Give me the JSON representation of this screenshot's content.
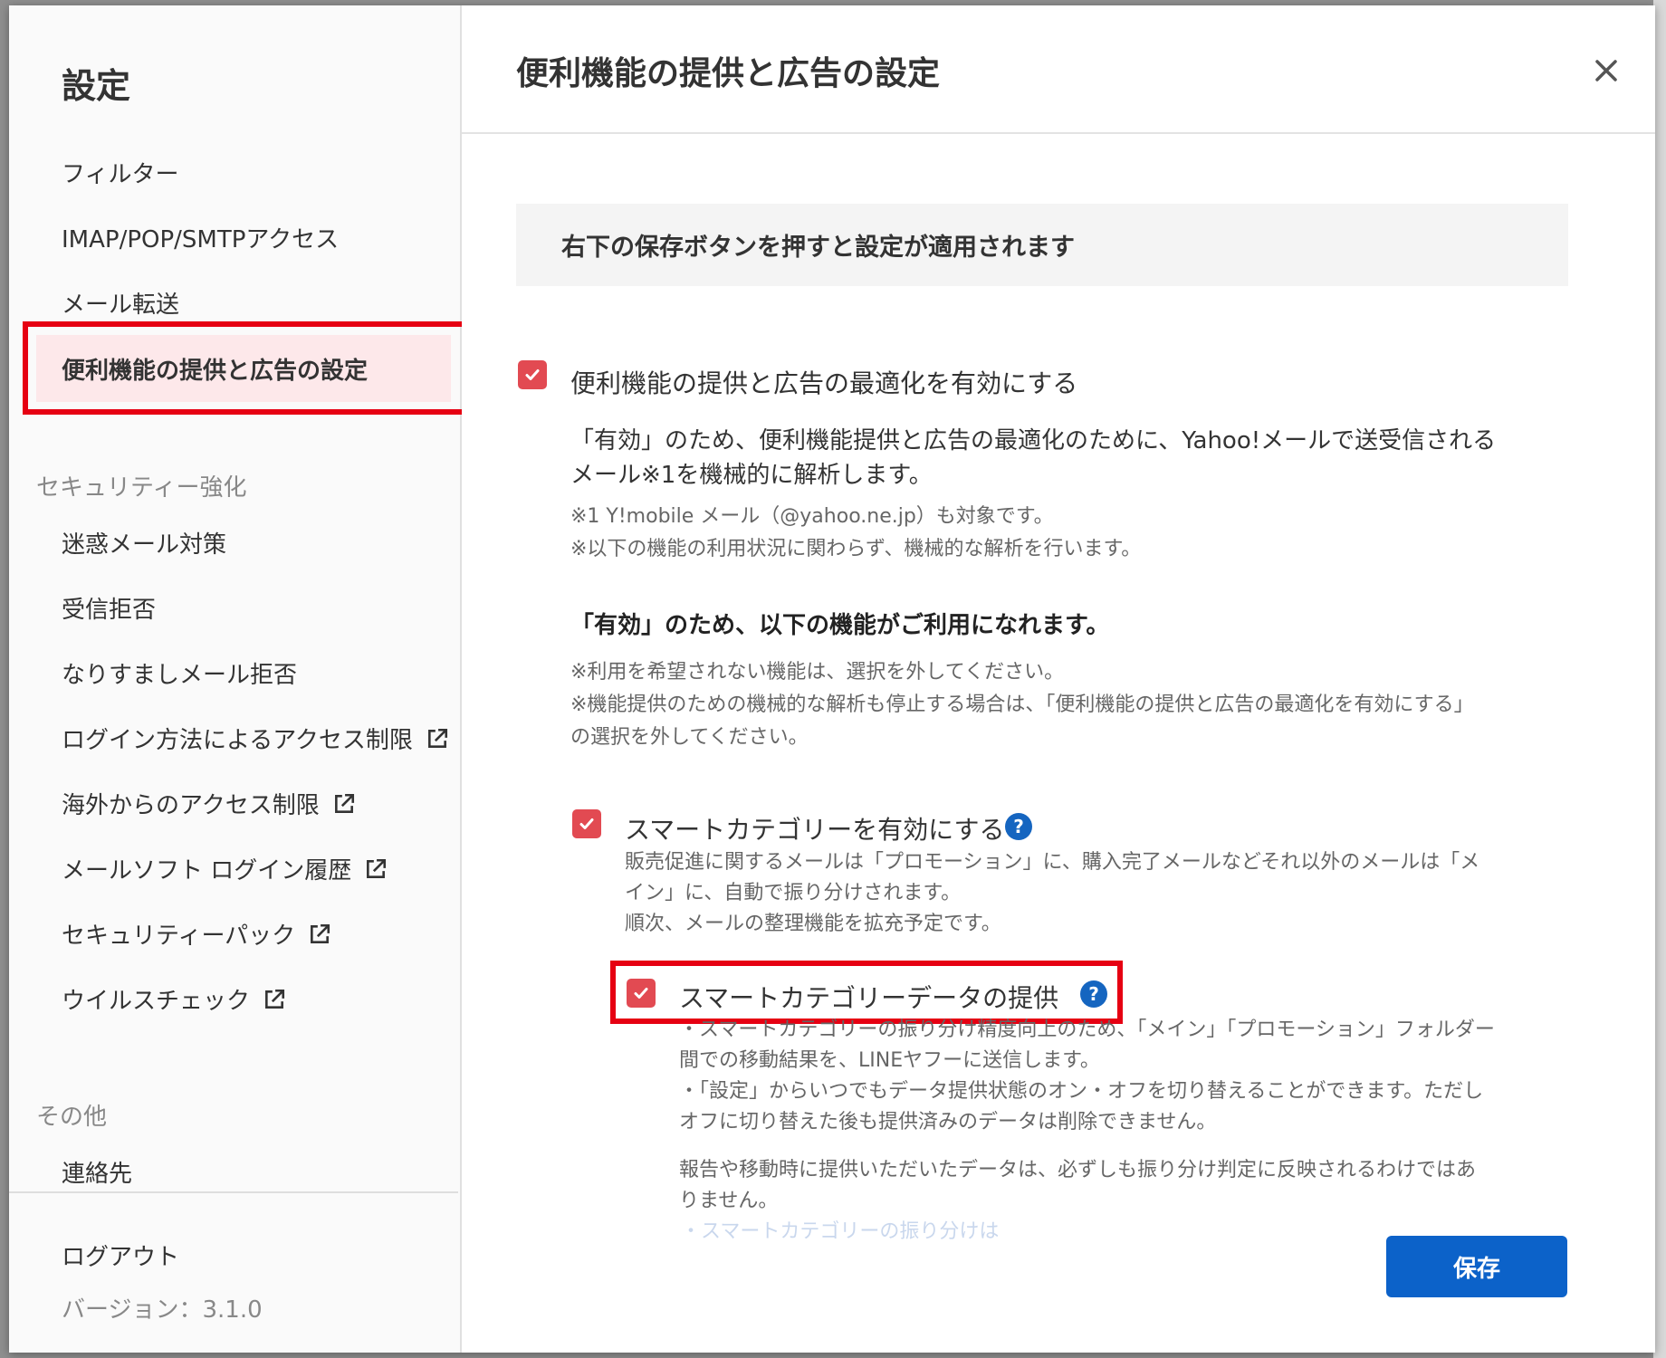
{
  "sidebar": {
    "title": "設定",
    "items": [
      {
        "label": "フィルター"
      },
      {
        "label": "IMAP/POP/SMTPアクセス"
      },
      {
        "label": "メール転送"
      }
    ],
    "active_item": "便利機能の提供と広告の設定",
    "sections": [
      {
        "title": "セキュリティー強化",
        "items": [
          {
            "label": "迷惑メール対策",
            "icon": ""
          },
          {
            "label": "受信拒否",
            "icon": ""
          },
          {
            "label": "なりすましメール拒否",
            "icon": ""
          },
          {
            "label": "ログイン方法によるアクセス制限",
            "icon": "external-link-icon"
          },
          {
            "label": "海外からのアクセス制限",
            "icon": "external-link-icon"
          },
          {
            "label": "メールソフト ログイン履歴",
            "icon": "external-link-icon"
          },
          {
            "label": "セキュリティーパック",
            "icon": "external-link-icon"
          },
          {
            "label": "ウイルスチェック",
            "icon": "external-link-icon"
          }
        ]
      },
      {
        "title": "その他",
        "items": [
          {
            "label": "連絡先"
          }
        ]
      }
    ],
    "logout": "ログアウト",
    "version": "バージョン：3.1.0"
  },
  "main": {
    "title": "便利機能の提供と広告の設定",
    "close_icon": "close-icon",
    "notice": "右下の保存ボタンを押すと設定が適用されます",
    "opt_main": {
      "label": "便利機能の提供と広告の最適化を有効にする",
      "checked": true,
      "desc_line1": "「有効」のため、便利機能提供と広告の最適化のために、Yahoo!メールで送受信される",
      "desc_line2": "メール※1を機械的に解析します。",
      "note1": "※1 Y!mobile メール（@yahoo.ne.jp）も対象です。",
      "note2": "※以下の機能の利用状況に関わらず、機械的な解析を行います。"
    },
    "features_heading": "「有効」のため、以下の機能がご利用になれます。",
    "features_note1": "※利用を希望されない機能は、選択を外してください。",
    "features_note2": "※機能提供のための機械的な解析も停止する場合は、「便利機能の提供と広告の最適化を有効にする」",
    "features_note3": "の選択を外してください。",
    "smart_category": {
      "label": "スマートカテゴリーを有効にする",
      "checked": true,
      "desc1": "販売促進に関するメールは「プロモーション」に、購入完了メールなどそれ以外のメールは「メ",
      "desc2": "イン」に、自動で振り分けされます。",
      "desc3": "順次、メールの整理機能を拡充予定です。"
    },
    "smart_category_data": {
      "label": "スマートカテゴリーデータの提供",
      "checked": true,
      "desc1": "・スマートカテゴリーの振り分け精度向上のため、「メイン」「プロモーション」フォルダー",
      "desc2": "間での移動結果を、LINEヤフーに送信します。",
      "desc3": "・「設定」からいつでもデータ提供状態のオン・オフを切り替えることができます。ただし",
      "desc4": "オフに切り替えた後も提供済みのデータは削除できません。",
      "desc5": "報告や移動時に提供いただいたデータは、必ずしも振り分け判定に反映されるわけではあ",
      "desc6": "りません。"
    },
    "faded_link": "・スマートカテゴリーの振り分けは",
    "save_label": "保存"
  },
  "colors": {
    "accent_red": "#e24a52",
    "highlight_red": "#e60012",
    "save_blue": "#0c62c9",
    "help_blue": "#1565c0",
    "active_bg": "#fde8ea"
  }
}
